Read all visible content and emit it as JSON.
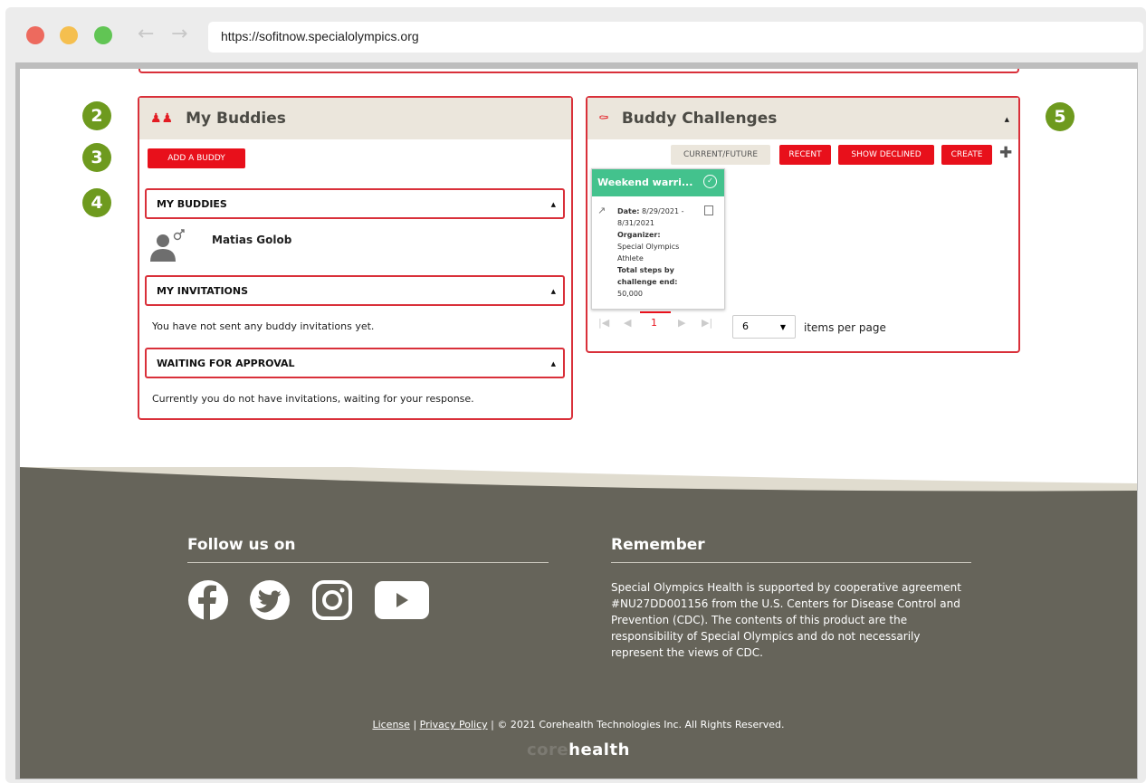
{
  "browser": {
    "url": "https://sofitnow.specialolympics.org",
    "traffic_lights": [
      "#ed6a5e",
      "#f5bf4f",
      "#61c554"
    ],
    "back_icon": "arrow-left-icon",
    "forward_icon": "arrow-right-icon"
  },
  "steps": [
    "2",
    "3",
    "4",
    "5"
  ],
  "buddies_panel": {
    "title": "My Buddies",
    "add_button": "ADD A BUDDY",
    "my_buddies_header": "MY BUDDIES",
    "buddy_name": "Matias Golob",
    "invitations_header": "MY INVITATIONS",
    "invitations_text": "You have not sent any buddy invitations yet.",
    "waiting_header": "WAITING FOR APPROVAL",
    "waiting_text": "Currently you do not have invitations, waiting for your response."
  },
  "challenges_panel": {
    "title": "Buddy Challenges",
    "tabs": [
      "CURRENT/FUTURE",
      "RECENT",
      "SHOW DECLINED",
      "CREATE"
    ],
    "card": {
      "title": "Weekend warri...",
      "date_label": "Date:",
      "date_value": "8/29/2021 -",
      "date_value2": "8/31/2021",
      "organizer_label": "Organizer:",
      "organizer_line1": "Special Olympics",
      "organizer_line2": "Athlete",
      "steps_label1": "Total steps by",
      "steps_label2": "challenge end:",
      "steps_value": "50,000"
    },
    "pager": {
      "current_page": "1",
      "per_page": "6",
      "per_page_label": "items per page"
    }
  },
  "footer": {
    "follow_title": "Follow us on",
    "remember_title": "Remember",
    "remember_text": "Special Olympics Health is supported by cooperative agreement #NU27DD001156 from the U.S. Centers for Disease Control and Prevention (CDC). The contents of this product are the responsibility of Special Olympics and do not necessarily represent the views of CDC.",
    "license": "License",
    "separator": "|",
    "privacy": "Privacy Policy",
    "copyright": "| © 2021 Corehealth Technologies Inc. All Rights Reserved.",
    "logo_dim": "core",
    "logo_bold": "health",
    "social_icons": [
      "facebook-icon",
      "twitter-icon",
      "instagram-icon",
      "youtube-icon"
    ]
  },
  "colors": {
    "accent_red": "#e8101b",
    "panel_border": "#d9303a",
    "footer_bg": "#66645a",
    "step_green": "#6e9a1e",
    "card_green": "#43c28d"
  }
}
